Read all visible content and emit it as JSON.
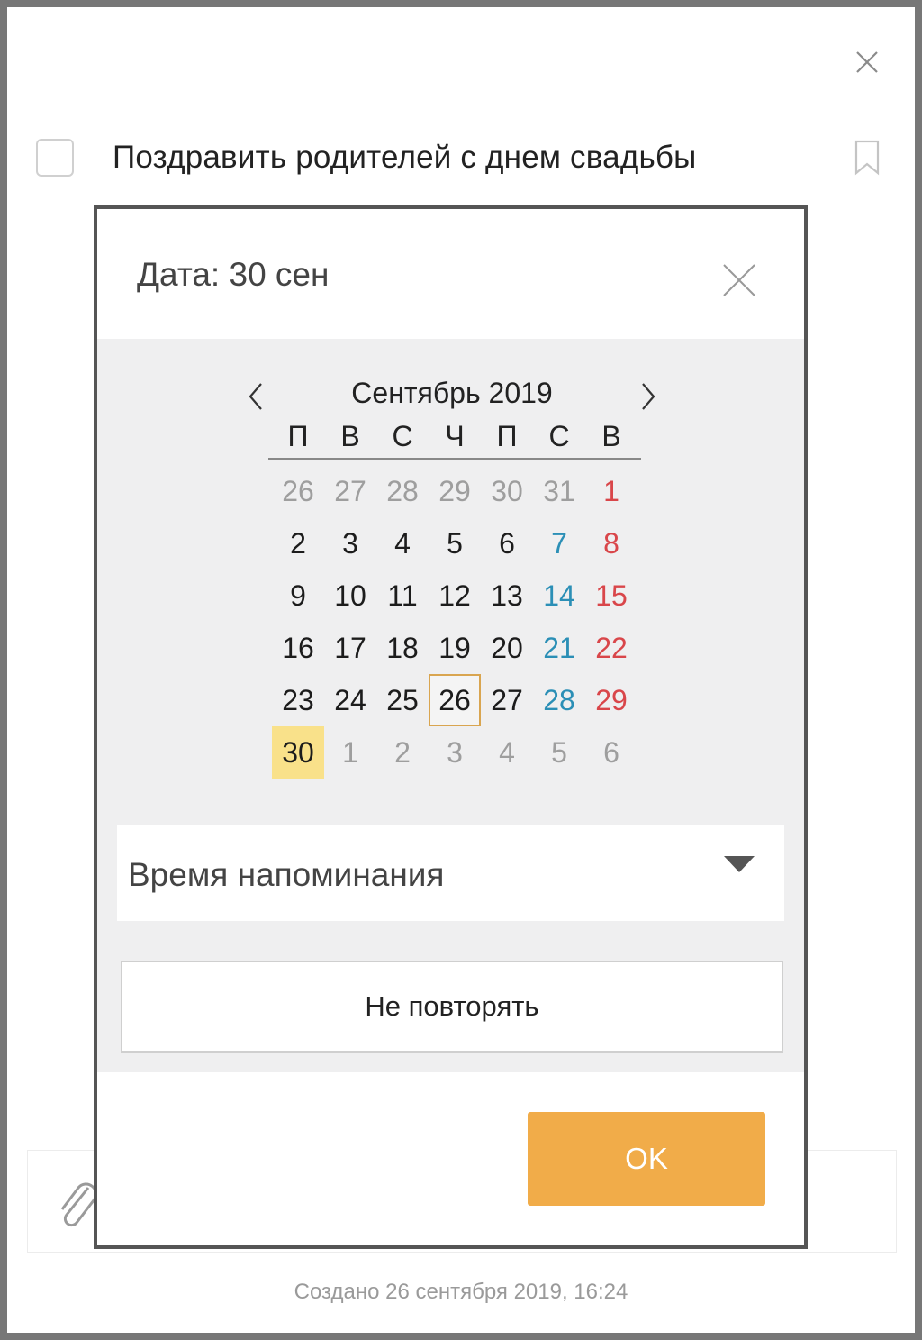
{
  "task": {
    "title": "Поздравить родителей с днем свадьбы",
    "created": "Создано 26 сентября 2019, 16:24"
  },
  "popup": {
    "title": "Дата: 30 сен",
    "calendar": {
      "month_label": "Сентябрь 2019",
      "weekdays": [
        "П",
        "В",
        "С",
        "Ч",
        "П",
        "С",
        "В"
      ],
      "weeks": [
        [
          {
            "d": "26",
            "t": "muted"
          },
          {
            "d": "27",
            "t": "muted"
          },
          {
            "d": "28",
            "t": "muted"
          },
          {
            "d": "29",
            "t": "muted"
          },
          {
            "d": "30",
            "t": "muted"
          },
          {
            "d": "31",
            "t": "muted"
          },
          {
            "d": "1",
            "t": "sun"
          }
        ],
        [
          {
            "d": "2",
            "t": "cur"
          },
          {
            "d": "3",
            "t": "cur"
          },
          {
            "d": "4",
            "t": "cur"
          },
          {
            "d": "5",
            "t": "cur"
          },
          {
            "d": "6",
            "t": "cur"
          },
          {
            "d": "7",
            "t": "sat"
          },
          {
            "d": "8",
            "t": "sun"
          }
        ],
        [
          {
            "d": "9",
            "t": "cur"
          },
          {
            "d": "10",
            "t": "cur"
          },
          {
            "d": "11",
            "t": "cur"
          },
          {
            "d": "12",
            "t": "cur"
          },
          {
            "d": "13",
            "t": "cur"
          },
          {
            "d": "14",
            "t": "sat"
          },
          {
            "d": "15",
            "t": "sun"
          }
        ],
        [
          {
            "d": "16",
            "t": "cur"
          },
          {
            "d": "17",
            "t": "cur"
          },
          {
            "d": "18",
            "t": "cur"
          },
          {
            "d": "19",
            "t": "cur"
          },
          {
            "d": "20",
            "t": "cur"
          },
          {
            "d": "21",
            "t": "sat"
          },
          {
            "d": "22",
            "t": "sun"
          }
        ],
        [
          {
            "d": "23",
            "t": "cur"
          },
          {
            "d": "24",
            "t": "cur"
          },
          {
            "d": "25",
            "t": "cur"
          },
          {
            "d": "26",
            "t": "cur today"
          },
          {
            "d": "27",
            "t": "cur"
          },
          {
            "d": "28",
            "t": "sat"
          },
          {
            "d": "29",
            "t": "sun"
          }
        ],
        [
          {
            "d": "30",
            "t": "selected"
          },
          {
            "d": "1",
            "t": "muted"
          },
          {
            "d": "2",
            "t": "muted"
          },
          {
            "d": "3",
            "t": "muted"
          },
          {
            "d": "4",
            "t": "muted"
          },
          {
            "d": "5",
            "t": "muted"
          },
          {
            "d": "6",
            "t": "muted"
          }
        ]
      ],
      "today": "26",
      "selected": "30"
    },
    "reminder_label": "Время напоминания",
    "repeat_label": "Не повторять",
    "ok_label": "OK"
  },
  "colors": {
    "accent": "#f1ac49",
    "selected_day": "#f9e18a",
    "today_border": "#d9a550",
    "saturday": "#2b8fb6",
    "sunday": "#d9464a"
  }
}
